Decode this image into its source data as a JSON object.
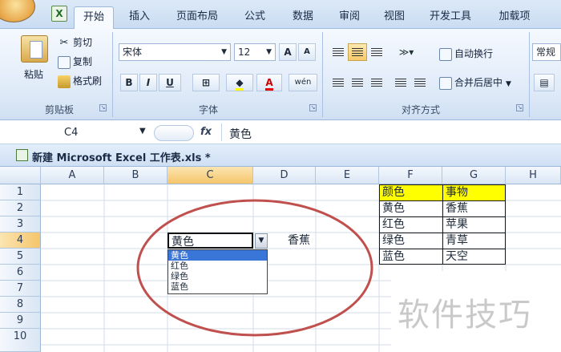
{
  "ribbon": {
    "tabs": [
      {
        "label": "开始",
        "active": true
      },
      {
        "label": "插入"
      },
      {
        "label": "页面布局"
      },
      {
        "label": "公式"
      },
      {
        "label": "数据"
      },
      {
        "label": "审阅"
      },
      {
        "label": "视图"
      },
      {
        "label": "开发工具"
      },
      {
        "label": "加载项"
      }
    ],
    "clipboard": {
      "paste": "粘贴",
      "cut": "剪切",
      "copy": "复制",
      "format_painter": "格式刷",
      "group": "剪贴板"
    },
    "font": {
      "name": "宋体",
      "size": "12",
      "bold": "B",
      "italic": "I",
      "underline": "U",
      "grow": "A",
      "shrink": "A",
      "phonetic": "wén",
      "group": "字体"
    },
    "alignment": {
      "wrap": "自动换行",
      "merge": "合并后居中",
      "group": "对齐方式"
    },
    "number": {
      "format": "常规"
    }
  },
  "formula_bar": {
    "cell_ref": "C4",
    "fx": "fx",
    "content": "黄色"
  },
  "workbook": {
    "title": "新建 Microsoft Excel 工作表.xls *"
  },
  "sheet": {
    "columns": [
      "A",
      "B",
      "C",
      "D",
      "E",
      "F",
      "G",
      "H"
    ],
    "rows": [
      "1",
      "2",
      "3",
      "4",
      "5",
      "6",
      "7",
      "8",
      "9",
      "10"
    ],
    "cells": {
      "C4": "黄色",
      "D4": "香蕉",
      "F1": "颜色",
      "G1": "事物",
      "F2": "黄色",
      "G2": "香蕉",
      "F3": "红色",
      "G3": "苹果",
      "F4": "绿色",
      "G4": "青草",
      "F5": "蓝色",
      "G5": "天空"
    },
    "dropdown_options": [
      "黄色",
      "红色",
      "绿色",
      "蓝色"
    ],
    "dropdown_selected": "黄色",
    "header_highlight": "#ffff00",
    "annotation_color": "#c0504d"
  },
  "watermark": "软件技巧"
}
